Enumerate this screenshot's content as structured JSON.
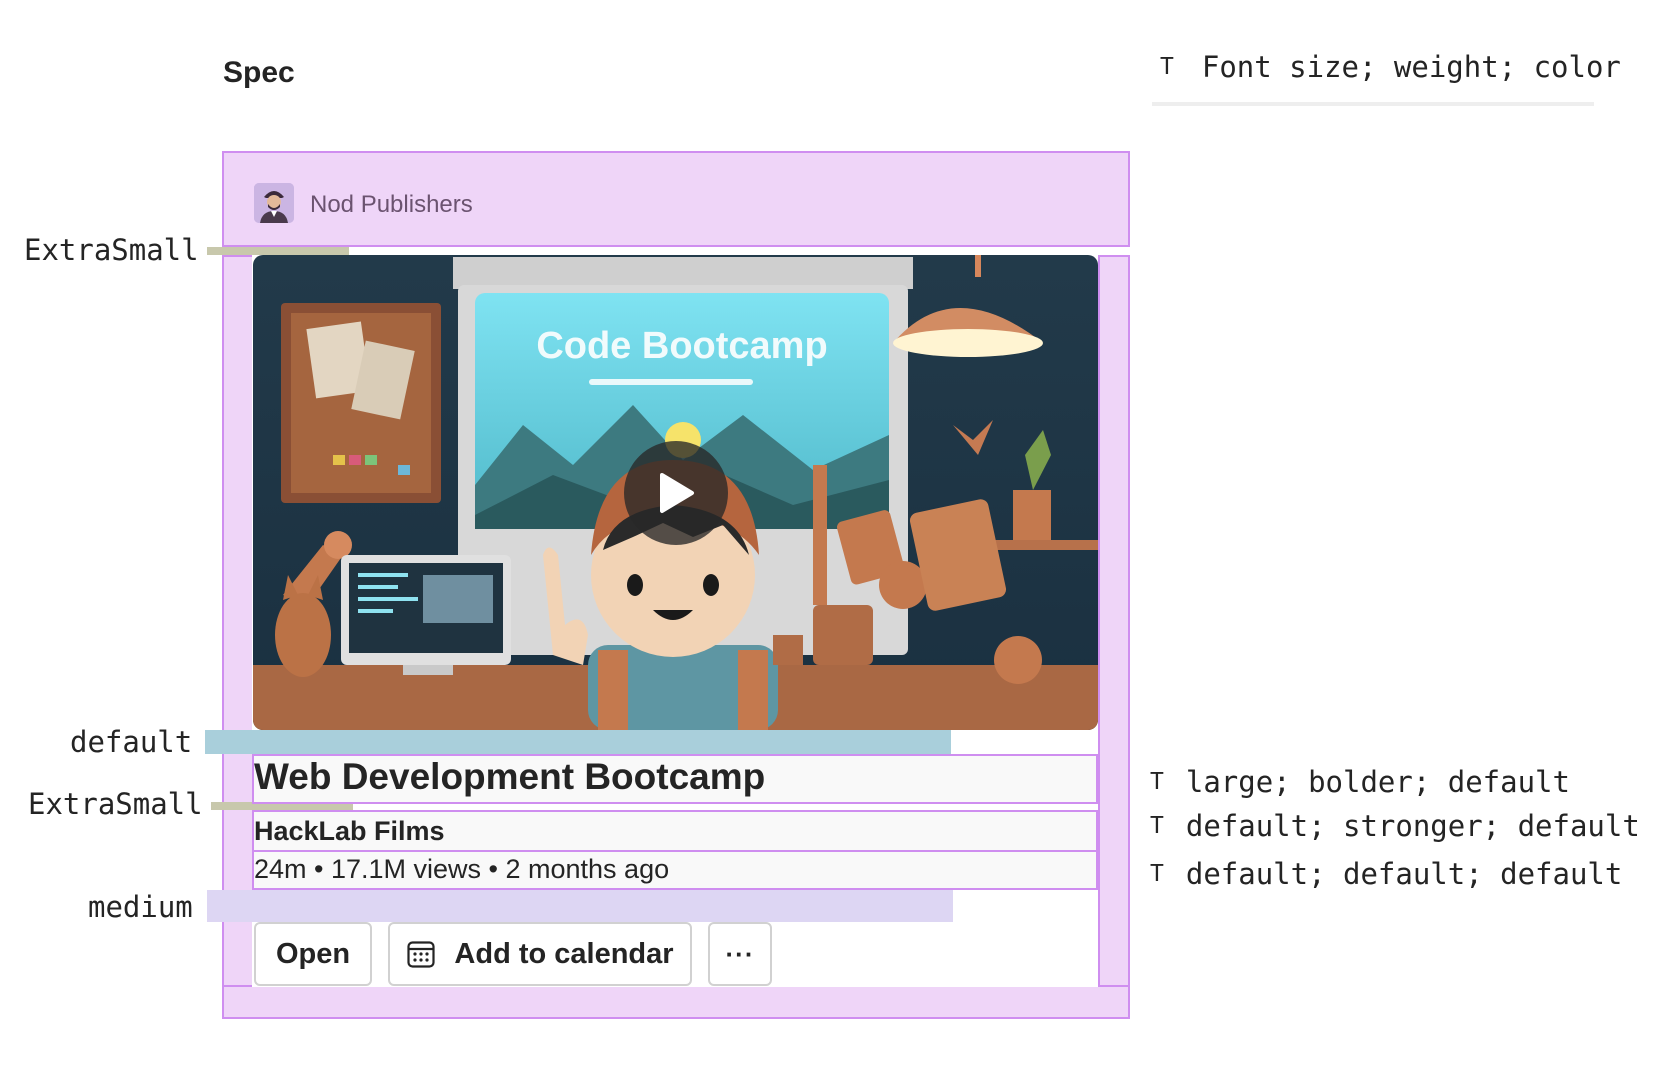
{
  "spec": {
    "title": "Spec"
  },
  "legend": {
    "icon": "T",
    "text": "Font size; weight; color"
  },
  "spacing_labels": {
    "extra_small_1": "ExtraSmall",
    "default": "default",
    "extra_small_2": "ExtraSmall",
    "medium": "medium"
  },
  "card": {
    "publisher": {
      "name": "Nod Publishers",
      "avatar_icon": "person-avatar-icon"
    },
    "thumbnail": {
      "caption": "Code Bootcamp",
      "play_icon": "play-icon"
    },
    "title": "Web Development Bootcamp",
    "channel": "HackLab Films",
    "meta": "24m • 17.1M views • 2 months ago",
    "buttons": {
      "open": "Open",
      "calendar": "Add to calendar",
      "calendar_icon": "calendar-icon",
      "more": "···"
    }
  },
  "tokens": {
    "title": "large; bolder; default",
    "subtitle": "default; stronger; default",
    "meta": "default; default; default"
  },
  "colors": {
    "region_fill": "#efd5f8",
    "region_border": "#cf8ef0",
    "spacing_extra_small": "#c8c8ac",
    "spacing_default": "#a9cfdb",
    "spacing_medium": "#ddd6f3"
  }
}
